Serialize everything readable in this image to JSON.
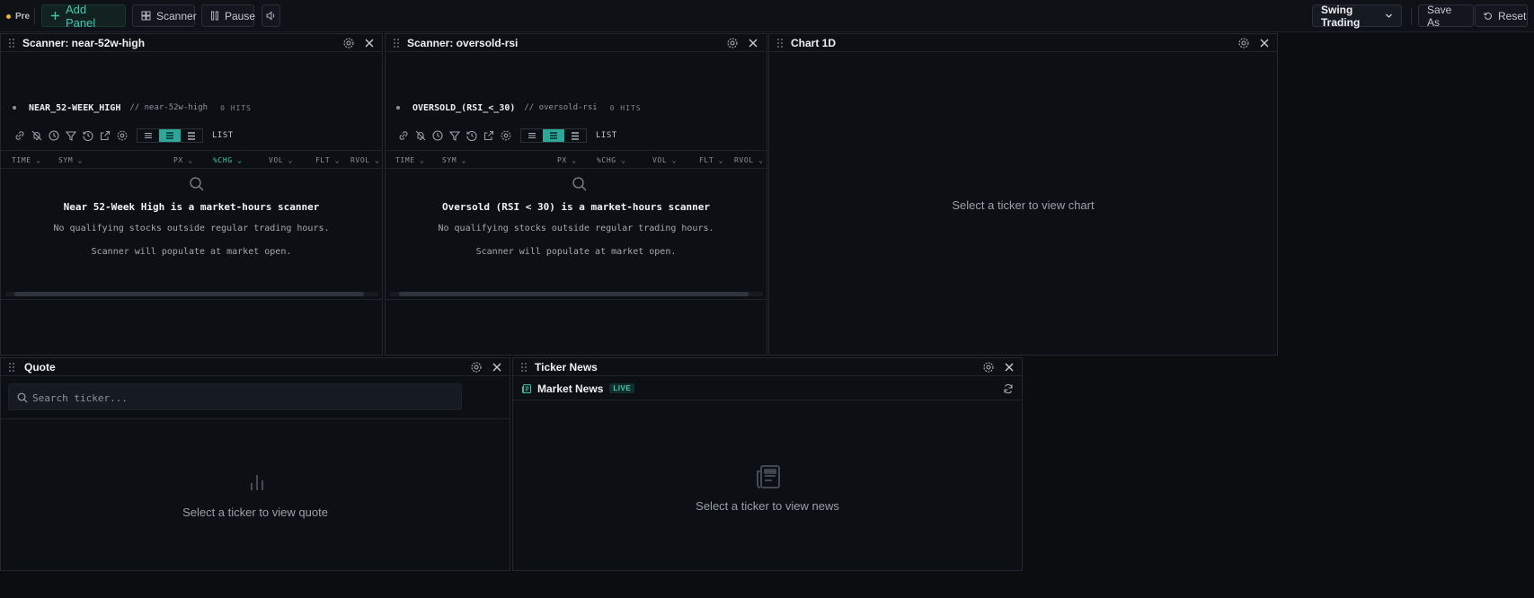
{
  "topbar": {
    "status": "Pre",
    "add_panel": "Add Panel",
    "scanner": "Scanner",
    "pause": "Pause",
    "layout_select": "Swing Trading",
    "save_as": "Save As",
    "reset": "Reset"
  },
  "scanner1": {
    "title": "Scanner: near-52w-high",
    "scan_id": "NEAR_52-WEEK_HIGH",
    "slug": "// near-52w-high",
    "hits": "0 HITS",
    "view_label": "LIST",
    "columns": [
      "TIME",
      "SYM",
      "PX",
      "%CHG",
      "VOL",
      "FLT",
      "RVOL"
    ],
    "sorted_column": "%CHG",
    "empty_title": "Near 52-Week High is a market-hours scanner",
    "empty_line1": "No qualifying stocks outside regular trading hours.",
    "empty_line2": "Scanner will populate at market open."
  },
  "scanner2": {
    "title": "Scanner: oversold-rsi",
    "scan_id": "OVERSOLD_(RSI_<_30)",
    "slug": "// oversold-rsi",
    "hits": "0 HITS",
    "view_label": "LIST",
    "columns": [
      "TIME",
      "SYM",
      "PX",
      "%CHG",
      "VOL",
      "FLT",
      "RVOL"
    ],
    "empty_title": "Oversold (RSI < 30) is a market-hours scanner",
    "empty_line1": "No qualifying stocks outside regular trading hours.",
    "empty_line2": "Scanner will populate at market open."
  },
  "chart": {
    "title": "Chart 1D",
    "empty": "Select a ticker to view chart"
  },
  "quote": {
    "title": "Quote",
    "search_placeholder": "Search ticker...",
    "empty": "Select a ticker to view quote"
  },
  "news": {
    "title": "Ticker News",
    "feed_label": "Market News",
    "live_badge": "LIVE",
    "empty": "Select a ticker to view news"
  },
  "colors": {
    "accent": "#3fc8b0",
    "status_dot": "#e7b72f",
    "background": "#0b0d11"
  }
}
